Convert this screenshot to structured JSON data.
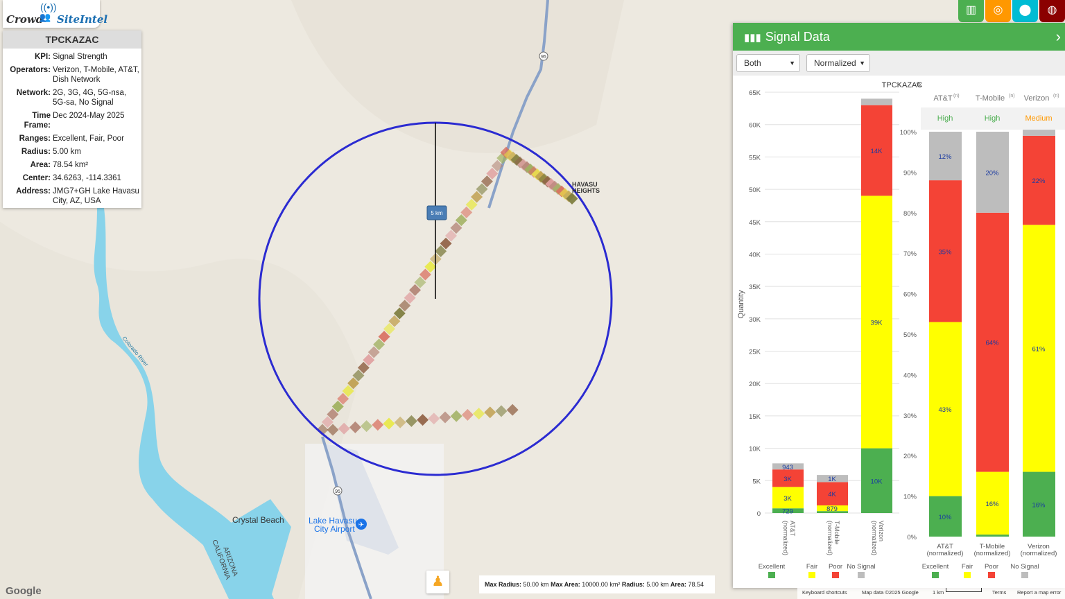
{
  "app": {
    "logo_left": "Crowd",
    "logo_right": "SiteIntel"
  },
  "info": {
    "title": "TPCKAZAC",
    "rows": [
      {
        "k": "KPI:",
        "v": "Signal Strength"
      },
      {
        "k": "Operators:",
        "v": "Verizon, T-Mobile, AT&T, Dish Network"
      },
      {
        "k": "Network:",
        "v": "2G, 3G, 4G, 5G-nsa, 5G-sa, No Signal"
      },
      {
        "k": "Time Frame:",
        "v": "Dec 2024-May 2025"
      },
      {
        "k": "Ranges:",
        "v": "Excellent, Fair, Poor"
      },
      {
        "k": "Radius:",
        "v": "5.00 km"
      },
      {
        "k": "Area:",
        "v": "78.54 km²"
      },
      {
        "k": "Center:",
        "v": "34.6263, -114.3361"
      },
      {
        "k": "Address:",
        "v": "JMG7+GH Lake Havasu City, AZ, USA"
      }
    ]
  },
  "map": {
    "radius_label": "5 km",
    "places": {
      "havasu1": "HAVASU",
      "havasu2": "HEIGHTS",
      "crystal": "Crystal Beach",
      "airport1": "Lake Havasu",
      "airport2": "City Airport",
      "river": "Colorado River",
      "az": "ARIZONA",
      "ca": "CALIFORNIA",
      "hw95a": "95",
      "hw95b": "95"
    },
    "circle_color": "#2b2bd1"
  },
  "toolbar": {
    "colors": [
      "#4caf50",
      "#ff9800",
      "#00bcd4",
      "#8b0000"
    ],
    "icons": [
      "bar-chart-icon",
      "target-icon",
      "pin-icon",
      "globe-icon"
    ]
  },
  "panel": {
    "title": "Signal Data",
    "select1": "Both",
    "select2": "Normalized",
    "colors": {
      "excellent": "#4caf50",
      "fair": "#ffff00",
      "poor": "#f44336",
      "nosignal": "#bdbdbd"
    },
    "legend": [
      "Excellent",
      "Fair",
      "Poor",
      "No Signal"
    ]
  },
  "chart_data": [
    {
      "type": "bar",
      "title": "TPCKAZAC",
      "ylabel": "Quantity",
      "ylim": [
        0,
        65000
      ],
      "yticks": [
        "0",
        "5K",
        "10K",
        "15K",
        "20K",
        "25K",
        "30K",
        "35K",
        "40K",
        "45K",
        "50K",
        "55K",
        "60K",
        "65K"
      ],
      "categories": [
        "AT&T (normalized)",
        "T-Mobile (normalized)",
        "Verizon (normalized)"
      ],
      "series": [
        {
          "name": "Excellent",
          "values": [
            729,
            300,
            10000
          ],
          "labels": [
            "729",
            "",
            "10K"
          ]
        },
        {
          "name": "Fair",
          "values": [
            3300,
            879,
            39000
          ],
          "labels": [
            "3K",
            "879",
            "39K"
          ]
        },
        {
          "name": "Poor",
          "values": [
            2700,
            3600,
            14000
          ],
          "labels": [
            "3K",
            "4K",
            "14K"
          ]
        },
        {
          "name": "No Signal",
          "values": [
            943,
            1100,
            1000
          ],
          "labels": [
            "943",
            "1K",
            ""
          ]
        }
      ]
    },
    {
      "type": "bar",
      "ylim": [
        0,
        100
      ],
      "yticks": [
        "0%",
        "10%",
        "20%",
        "30%",
        "40%",
        "50%",
        "60%",
        "70%",
        "80%",
        "90%",
        "100%"
      ],
      "columns": [
        {
          "name": "AT&T",
          "sup": "(n)",
          "rating": "High",
          "rating_color": "#4caf50",
          "label1": "AT&T",
          "label2": "(normalized)"
        },
        {
          "name": "T-Mobile",
          "sup": "(n)",
          "rating": "High",
          "rating_color": "#4caf50",
          "label1": "T-Mobile",
          "label2": "(normalized)"
        },
        {
          "name": "Verizon",
          "sup": "(n)",
          "rating": "Medium",
          "rating_color": "#ff9800",
          "label1": "Verizon",
          "label2": "(normalized)"
        }
      ],
      "series": [
        {
          "name": "Excellent",
          "values": [
            10,
            0.5,
            16
          ],
          "labels": [
            "10%",
            "",
            "16%"
          ]
        },
        {
          "name": "Fair",
          "values": [
            43,
            15.5,
            61
          ],
          "labels": [
            "43%",
            "16%",
            "61%"
          ]
        },
        {
          "name": "Poor",
          "values": [
            35,
            64,
            22
          ],
          "labels": [
            "35%",
            "64%",
            "22%"
          ]
        },
        {
          "name": "No Signal",
          "values": [
            12,
            20,
            1.5
          ],
          "labels": [
            "12%",
            "20%",
            ""
          ]
        }
      ]
    }
  ],
  "footer": {
    "max_radius_k": "Max Radius:",
    "max_radius_v": "50.00 km",
    "max_area_k": "Max Area:",
    "max_area_v": "10000.00 km²",
    "radius_k": "Radius:",
    "radius_v": "5.00 km",
    "area_k": "Area:",
    "area_v": "78.54 km²",
    "google": "Google",
    "keyboard": "Keyboard shortcuts",
    "mapdata": "Map data ©2025 Google",
    "scale": "1 km",
    "terms": "Terms",
    "report": "Report a map error"
  }
}
